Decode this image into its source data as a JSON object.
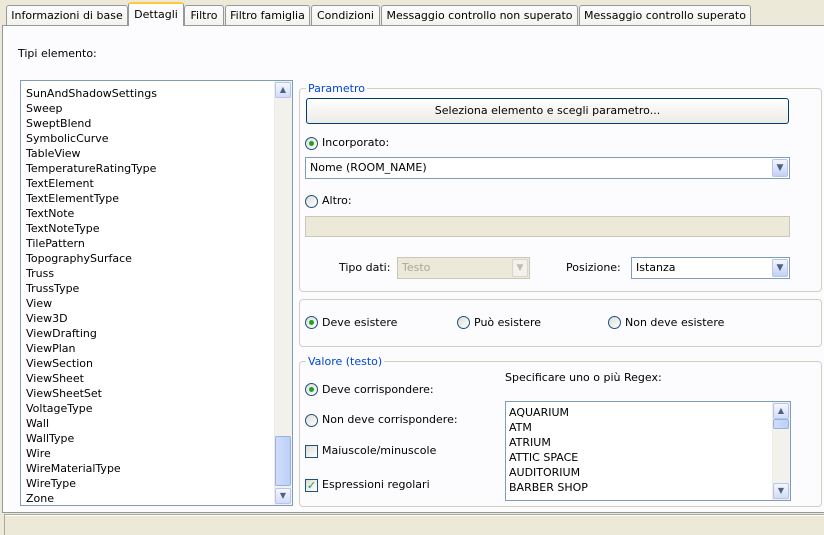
{
  "tabs": [
    {
      "label": "Informazioni di base"
    },
    {
      "label": "Dettagli"
    },
    {
      "label": "Filtro"
    },
    {
      "label": "Filtro famiglia"
    },
    {
      "label": "Condizioni"
    },
    {
      "label": "Messaggio controllo non superato"
    },
    {
      "label": "Messaggio controllo superato"
    }
  ],
  "element_types": {
    "label": "Tipi elemento:",
    "items": [
      "SunAndShadowSettings",
      "Sweep",
      "SweptBlend",
      "SymbolicCurve",
      "TableView",
      "TemperatureRatingType",
      "TextElement",
      "TextElementType",
      "TextNote",
      "TextNoteType",
      "TilePattern",
      "TopographySurface",
      "Truss",
      "TrussType",
      "View",
      "View3D",
      "ViewDrafting",
      "ViewPlan",
      "ViewSection",
      "ViewSheet",
      "ViewSheetSet",
      "VoltageType",
      "Wall",
      "WallType",
      "Wire",
      "WireMaterialType",
      "WireType",
      "Zone"
    ]
  },
  "parametro": {
    "title": "Parametro",
    "select_button": "Seleziona elemento e scegli parametro...",
    "incorporato_label": "Incorporato:",
    "incorporato_selected": true,
    "incorporato_value": "Nome (ROOM_NAME)",
    "altro_label": "Altro:",
    "altro_selected": false,
    "altro_value": "",
    "tipo_dati_label": "Tipo dati:",
    "tipo_dati_value": "Testo",
    "posizione_label": "Posizione:",
    "posizione_value": "Istanza"
  },
  "existence": {
    "options": [
      {
        "label": "Deve esistere",
        "selected": true
      },
      {
        "label": "Può esistere",
        "selected": false
      },
      {
        "label": "Non deve esistere",
        "selected": false
      }
    ]
  },
  "valore": {
    "title": "Valore (testo)",
    "match_label": "Deve corrispondere:",
    "match_selected": true,
    "nomatch_label": "Non deve corrispondere:",
    "nomatch_selected": false,
    "case_label": "Maiuscole/minuscole",
    "case_checked": false,
    "regex_label": "Espressioni regolari",
    "regex_checked": true,
    "regex_list_label": "Specificare uno o più Regex:",
    "regex_items": [
      "AQUARIUM",
      "ATM",
      "ATRIUM",
      "ATTIC SPACE",
      "AUDITORIUM",
      "BARBER SHOP"
    ]
  }
}
